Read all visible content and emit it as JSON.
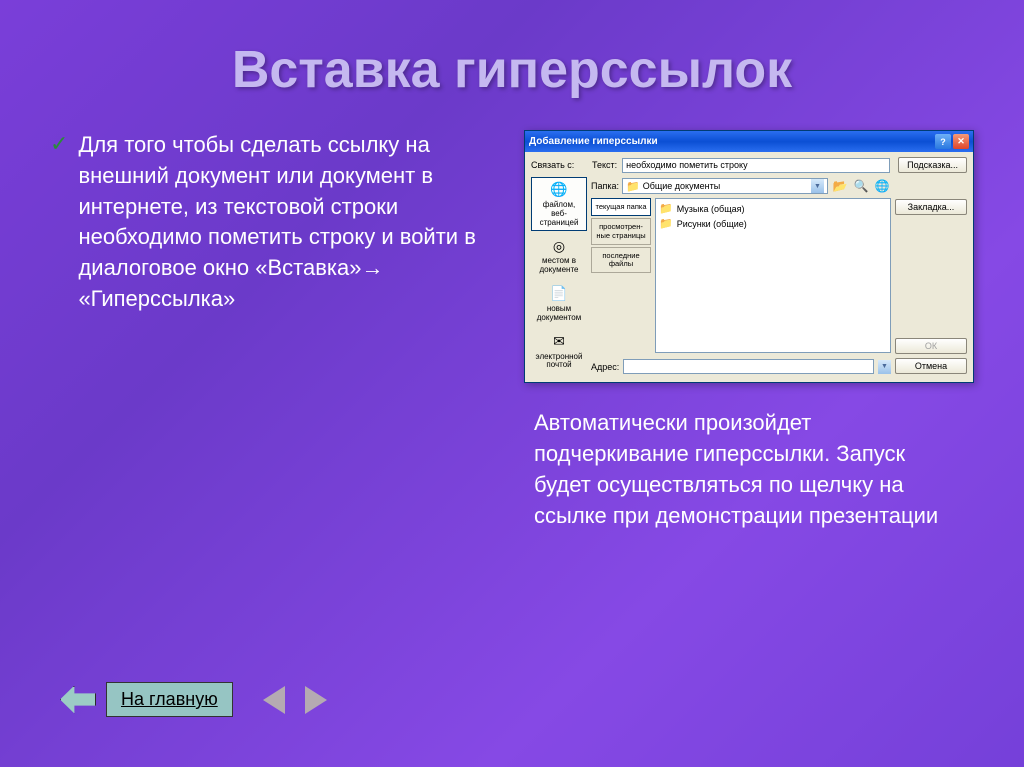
{
  "title": "Вставка гиперссылок",
  "bullet_text": "Для того чтобы сделать ссылку на внешний документ или документ в интернете,  из текстовой строки необходимо пометить строку   и войти в диалоговое окно «Вставка»→ «Гиперссылка»",
  "right_text": "Автоматически произойдет подчеркивание гиперссылки. Запуск будет осуществляться по щелчку на ссылке при демонстрации презентации",
  "home_button": "На главную",
  "dialog": {
    "title": "Добавление гиперссылки",
    "link_with": "Связать с:",
    "text_label": "Текст:",
    "text_value": "необходимо пометить строку",
    "hint_btn": "Подсказка...",
    "folder_label": "Папка:",
    "folder_value": "Общие документы",
    "sidebar": [
      "файлом, веб-страницей",
      "местом в документе",
      "новым документом",
      "электронной почтой"
    ],
    "tabs": [
      "текущая папка",
      "просмотрен-ные страницы",
      "последние файлы"
    ],
    "files": [
      "Музыка (общая)",
      "Рисунки (общие)"
    ],
    "bookmark_btn": "Закладка...",
    "addr_label": "Адрес:",
    "ok_btn": "ОК",
    "cancel_btn": "Отмена"
  }
}
